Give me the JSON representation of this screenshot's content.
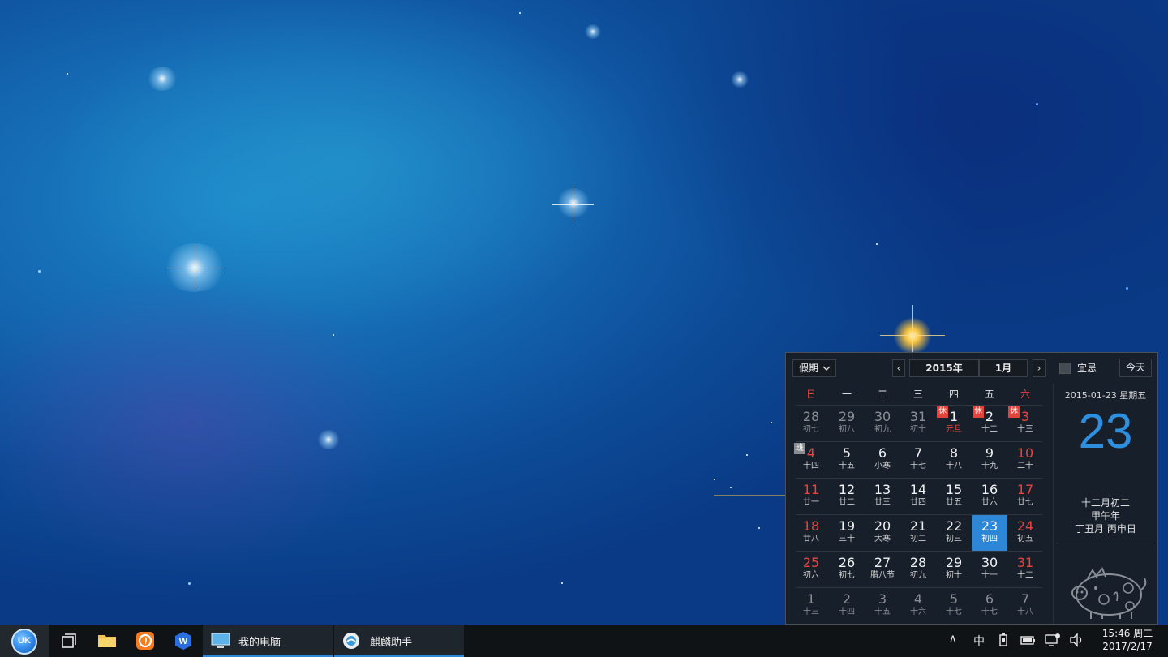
{
  "calendar": {
    "holiday_select": "假期",
    "year": "2015年",
    "month": "1月",
    "prev_arrow": "‹",
    "next_arrow": "›",
    "yi_label": "宜忌",
    "today_button": "今天",
    "weekdays": [
      "日",
      "一",
      "二",
      "三",
      "四",
      "五",
      "六"
    ],
    "weeks": [
      [
        {
          "num": "28",
          "lunar": "初七",
          "other": true
        },
        {
          "num": "29",
          "lunar": "初八",
          "other": true
        },
        {
          "num": "30",
          "lunar": "初九",
          "other": true
        },
        {
          "num": "31",
          "lunar": "初十",
          "other": true
        },
        {
          "num": "1",
          "lunar": "元旦",
          "badge": "休",
          "festival": true
        },
        {
          "num": "2",
          "lunar": "十二",
          "badge": "休"
        },
        {
          "num": "3",
          "lunar": "十三",
          "badge": "休",
          "weekend": true
        }
      ],
      [
        {
          "num": "4",
          "lunar": "十四",
          "badge": "班",
          "work": true,
          "weekend": true
        },
        {
          "num": "5",
          "lunar": "十五"
        },
        {
          "num": "6",
          "lunar": "小寒"
        },
        {
          "num": "7",
          "lunar": "十七"
        },
        {
          "num": "8",
          "lunar": "十八"
        },
        {
          "num": "9",
          "lunar": "十九"
        },
        {
          "num": "10",
          "lunar": "二十",
          "weekend": true
        }
      ],
      [
        {
          "num": "11",
          "lunar": "廿一",
          "weekend": true
        },
        {
          "num": "12",
          "lunar": "廿二"
        },
        {
          "num": "13",
          "lunar": "廿三"
        },
        {
          "num": "14",
          "lunar": "廿四"
        },
        {
          "num": "15",
          "lunar": "廿五"
        },
        {
          "num": "16",
          "lunar": "廿六"
        },
        {
          "num": "17",
          "lunar": "廿七",
          "weekend": true
        }
      ],
      [
        {
          "num": "18",
          "lunar": "廿八",
          "weekend": true
        },
        {
          "num": "19",
          "lunar": "三十"
        },
        {
          "num": "20",
          "lunar": "大寒"
        },
        {
          "num": "21",
          "lunar": "初二"
        },
        {
          "num": "22",
          "lunar": "初三"
        },
        {
          "num": "23",
          "lunar": "初四",
          "selected": true
        },
        {
          "num": "24",
          "lunar": "初五",
          "weekend": true
        }
      ],
      [
        {
          "num": "25",
          "lunar": "初六",
          "weekend": true
        },
        {
          "num": "26",
          "lunar": "初七"
        },
        {
          "num": "27",
          "lunar": "腊八节"
        },
        {
          "num": "28",
          "lunar": "初九"
        },
        {
          "num": "29",
          "lunar": "初十"
        },
        {
          "num": "30",
          "lunar": "十一"
        },
        {
          "num": "31",
          "lunar": "十二",
          "weekend": true
        }
      ],
      [
        {
          "num": "1",
          "lunar": "十三",
          "other": true
        },
        {
          "num": "2",
          "lunar": "十四",
          "other": true
        },
        {
          "num": "3",
          "lunar": "十五",
          "other": true
        },
        {
          "num": "4",
          "lunar": "十六",
          "other": true
        },
        {
          "num": "5",
          "lunar": "十七",
          "other": true
        },
        {
          "num": "6",
          "lunar": "十七",
          "other": true
        },
        {
          "num": "7",
          "lunar": "十八",
          "other": true
        }
      ]
    ],
    "detail": {
      "date_line": "2015-01-23 星期五",
      "big_day": "23",
      "lunar_date": "十二月初二",
      "year_ganzhi": "甲午年",
      "month_day_ganzhi": "丁丑月 丙申日",
      "zodiac_icon": "pig-zodiac-icon"
    }
  },
  "taskbar": {
    "start_logo": "UK",
    "pinned": [
      {
        "name": "multitask-view-icon"
      },
      {
        "name": "folder-icon"
      },
      {
        "name": "firefox-icon"
      },
      {
        "name": "wps-icon"
      }
    ],
    "tasks": [
      {
        "label": "我的电脑",
        "icon": "computer-icon"
      },
      {
        "label": "麒麟助手",
        "icon": "kylin-assistant-icon"
      }
    ],
    "tray": {
      "up_arrow": "∧",
      "ime": "中",
      "icons": [
        "usb-icon",
        "battery-icon",
        "network-icon",
        "volume-icon"
      ]
    },
    "clock": {
      "time_weekday": "15:46 周二",
      "date": "2017/2/17"
    }
  },
  "colors": {
    "accent_blue": "#2e86d6",
    "holiday_red": "#e0443a",
    "weekend_red": "#e8443c",
    "taskbar_bg": "#101316"
  }
}
